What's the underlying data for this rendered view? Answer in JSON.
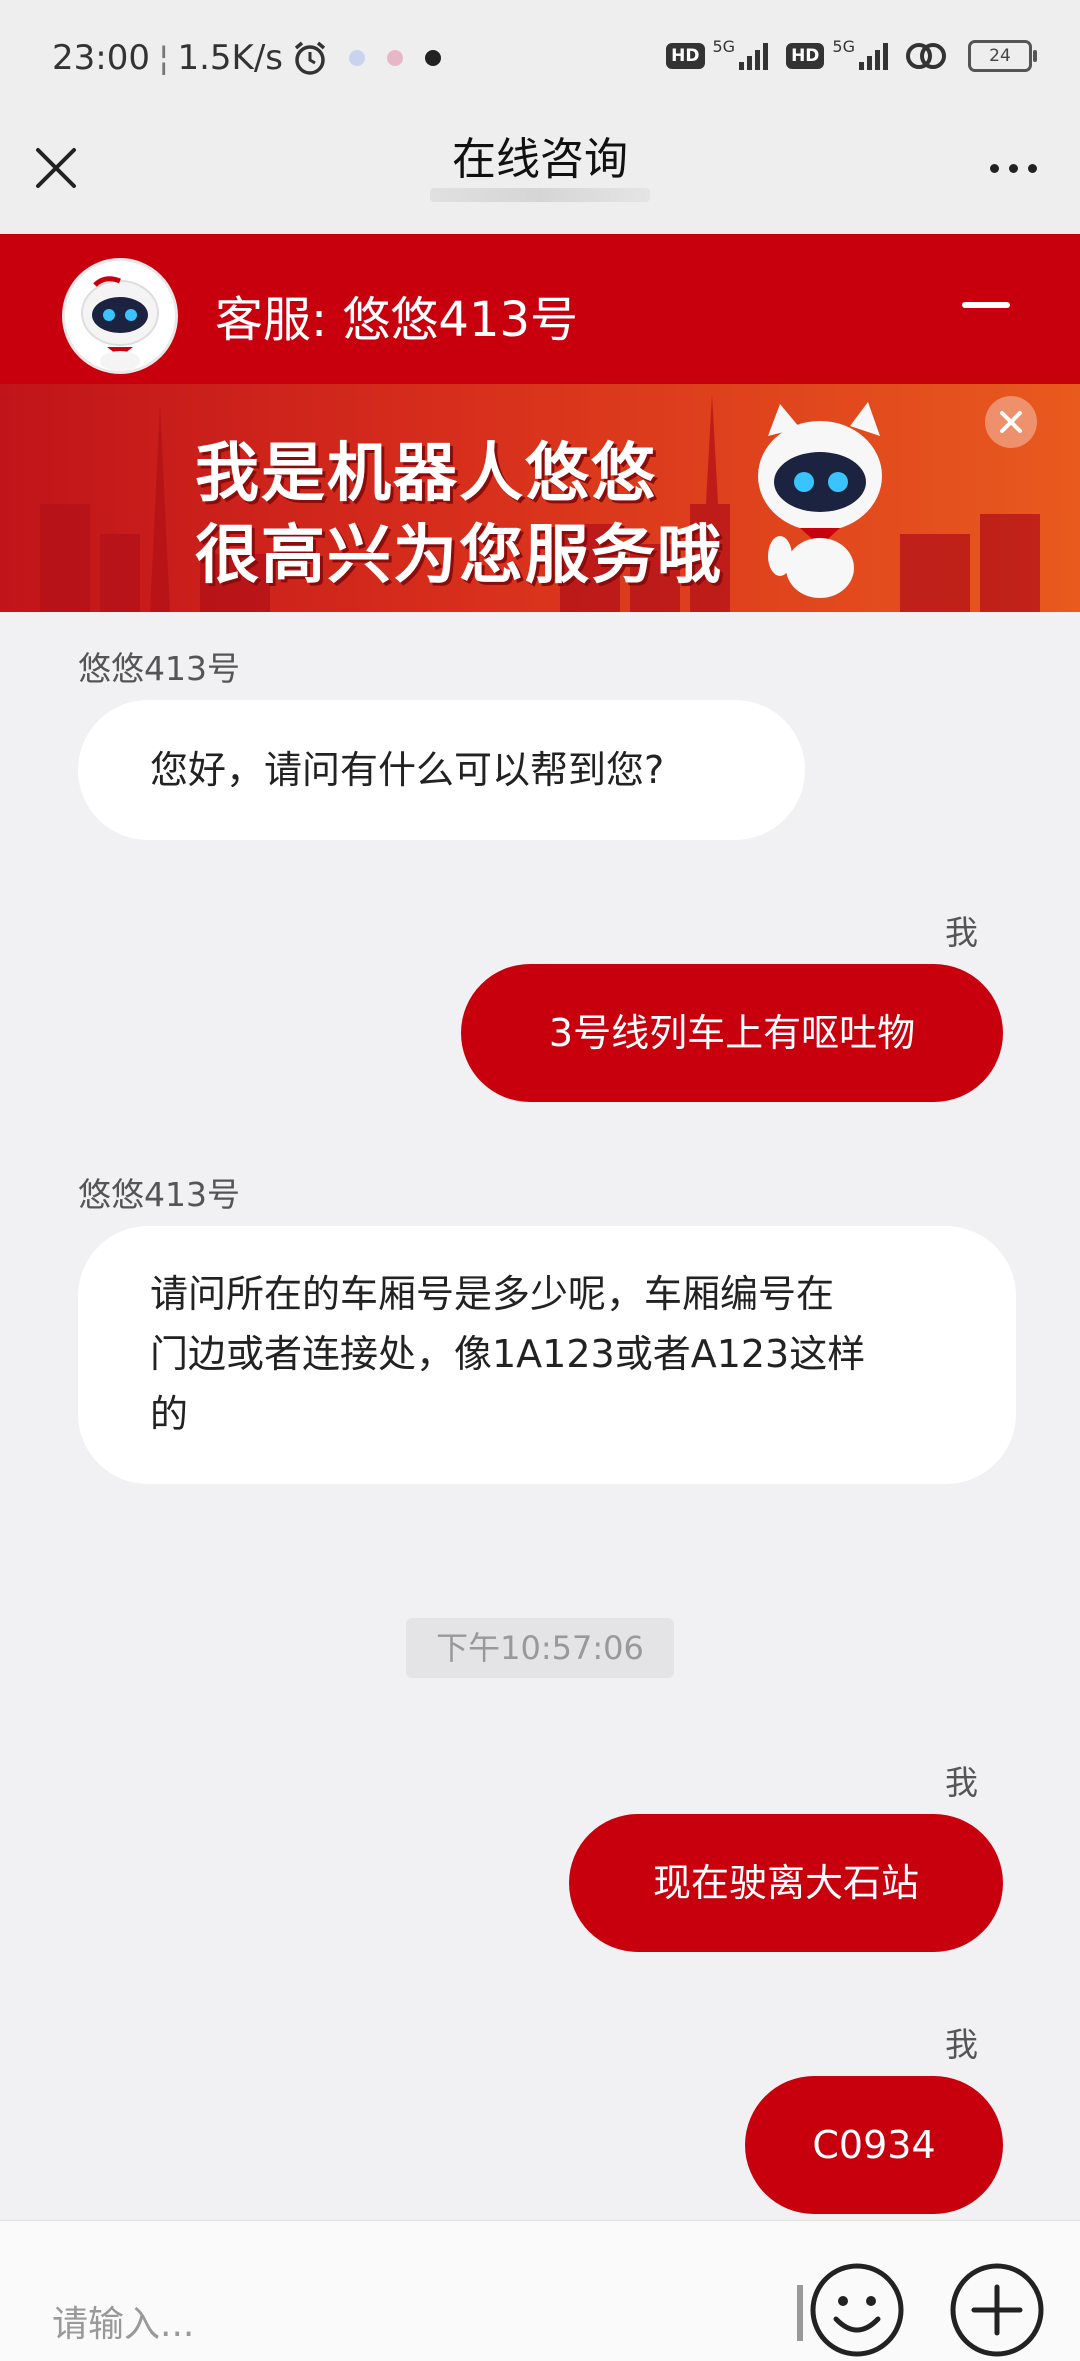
{
  "status_bar": {
    "time": "23:00",
    "net_speed": "1.5K/s",
    "battery": "24",
    "network_label_1": "HD",
    "network_gen_1": "5G",
    "network_label_2": "HD",
    "network_gen_2": "5G"
  },
  "nav": {
    "title": "在线咨询"
  },
  "agent": {
    "name": "客服: 悠悠413号"
  },
  "banner": {
    "line1": "我是机器人悠悠",
    "line2": "很高兴为您服务哦"
  },
  "messages": [
    {
      "sender": "悠悠413号",
      "text": "您好，请问有什么可以帮到您?"
    },
    {
      "sender": "我",
      "text": "3号线列车上有呕吐物"
    },
    {
      "sender": "悠悠413号",
      "lines": [
        "请问所在的车厢号是多少呢，车厢编号在",
        "门边或者连接处，像1A123或者A123这样",
        "的"
      ]
    },
    {
      "timestamp": "下午10:57:06"
    },
    {
      "sender": "我",
      "text": "现在驶离大石站"
    },
    {
      "sender": "我",
      "text": "C0934"
    }
  ],
  "input": {
    "placeholder": "请输入..."
  },
  "colors": {
    "brand_red": "#c8000e",
    "background": "#f1f1f3"
  }
}
